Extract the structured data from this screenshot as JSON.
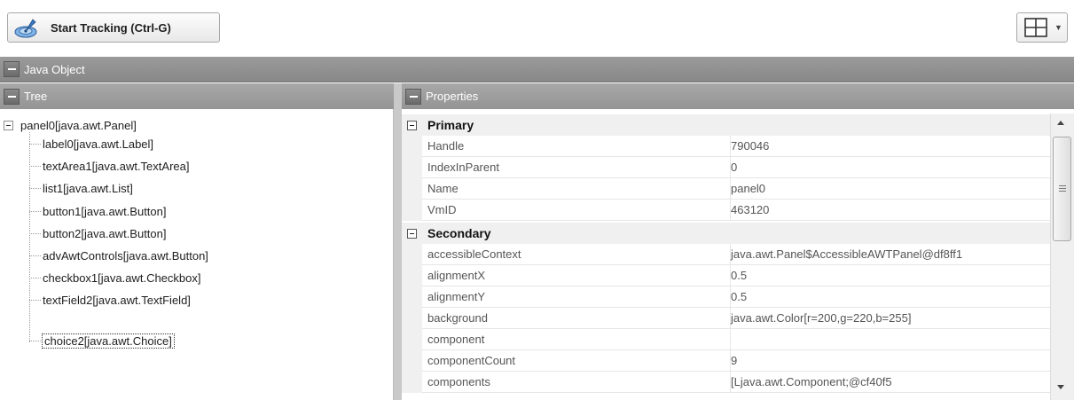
{
  "toolbar": {
    "start_label": "Start Tracking (Ctrl-G)",
    "start_icon": "tracking-radar-icon",
    "layout_icon": "grid-layout-icon"
  },
  "sections": {
    "java_object": "Java Object",
    "tree": "Tree",
    "properties": "Properties"
  },
  "tree": {
    "root": "panel0[java.awt.Panel]",
    "children": [
      "label0[java.awt.Label]",
      "textArea1[java.awt.TextArea]",
      "list1[java.awt.List]",
      "button1[java.awt.Button]",
      "button2[java.awt.Button]",
      "advAwtControls[java.awt.Button]",
      "checkbox1[java.awt.Checkbox]",
      "textField2[java.awt.TextField]",
      "choice2[java.awt.Choice]"
    ],
    "selected_index": 8
  },
  "properties": {
    "categories": [
      {
        "name": "Primary",
        "rows": [
          {
            "name": "Handle",
            "value": "790046"
          },
          {
            "name": "IndexInParent",
            "value": "0"
          },
          {
            "name": "Name",
            "value": "panel0"
          },
          {
            "name": "VmID",
            "value": "463120"
          }
        ]
      },
      {
        "name": "Secondary",
        "rows": [
          {
            "name": "accessibleContext",
            "value": "java.awt.Panel$AccessibleAWTPanel@df8ff1"
          },
          {
            "name": "alignmentX",
            "value": "0.5"
          },
          {
            "name": "alignmentY",
            "value": "0.5"
          },
          {
            "name": "background",
            "value": "java.awt.Color[r=200,g=220,b=255]"
          },
          {
            "name": "component",
            "value": ""
          },
          {
            "name": "componentCount",
            "value": "9"
          },
          {
            "name": "components",
            "value": "[Ljava.awt.Component;@cf40f5"
          }
        ]
      }
    ]
  },
  "colors": {
    "section_bar": "#909090",
    "category_bg": "#f0f0f0"
  }
}
